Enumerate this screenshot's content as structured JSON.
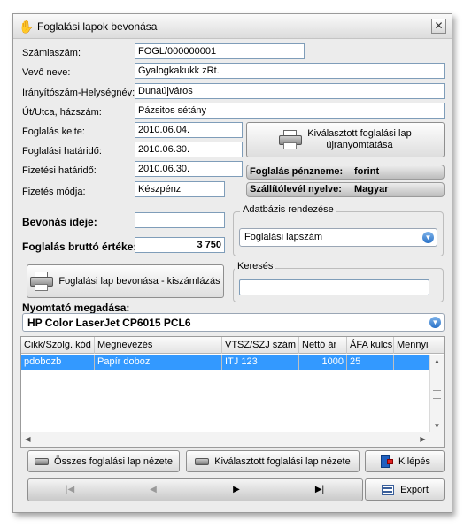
{
  "window": {
    "title": "Foglalási lapok bevonása",
    "close_glyph": "✕"
  },
  "form": {
    "szamlaszam_label": "Számlaszám:",
    "szamlaszam_value": "FOGL/000000001",
    "vevo_label": "Vevő neve:",
    "vevo_value": "Gyalogkakukk zRt.",
    "irsz_label": "Irányítószám-Helységnév:",
    "irsz_value": "Dunaújváros",
    "utca_label": "Út/Utca, házszám:",
    "utca_value": "Pázsitos sétány",
    "kelte_label": "Foglalás kelte:",
    "kelte_value": "2010.06.04.",
    "hatarido_label": "Foglalási határidő:",
    "hatarido_value": "2010.06.30.",
    "fizhatarido_label": "Fizetési határidő:",
    "fizhatarido_value": "2010.06.30.",
    "fizmod_label": "Fizetés módja:",
    "fizmod_value": "Készpénz",
    "bevonas_label": "Bevonás ideje:",
    "bevonas_value": "",
    "brutto_label": "Foglalás bruttó értéke:",
    "brutto_value": "3 750"
  },
  "print_selected_button": {
    "line1": "Kiválasztott foglalási lap",
    "line2": "újranyomtatása"
  },
  "penznem": {
    "label": "Foglalás pénzneme:",
    "value": "forint"
  },
  "nyelv": {
    "label": "Szállítólevél nyelve:",
    "value": "Magyar"
  },
  "adatbazis": {
    "title": "Adatbázis rendezése",
    "selected": "Foglalási lapszám"
  },
  "kereses": {
    "title": "Keresés",
    "value": ""
  },
  "bevonas_button": "Foglalási lap bevonása - kiszámlázás",
  "printer": {
    "label": "Nyomtató megadása:",
    "selected": "HP Color LaserJet CP6015 PCL6"
  },
  "grid": {
    "columns": [
      "Cikk/Szolg. kód",
      "Megnevezés",
      "VTSZ/SZJ szám",
      "Nettó ár",
      "ÁFA kulcs",
      "Mennyis"
    ],
    "rows": [
      {
        "kod": "pdobozb",
        "megnevezes": "Papír doboz",
        "vtsz": "ITJ 123",
        "netto": "1000",
        "afa": "25",
        "menny": ""
      }
    ]
  },
  "buttons": {
    "osszes": "Összes foglalási lap nézete",
    "kivalasztott": "Kiválasztott foglalási lap nézete",
    "kilepes": "Kilépés",
    "export": "Export"
  },
  "nav": {
    "first": "|◀",
    "prev": "◀",
    "next": "▶",
    "last": "▶|"
  },
  "colors": {
    "selection": "#3399ff",
    "window_bg": "#ececec"
  }
}
